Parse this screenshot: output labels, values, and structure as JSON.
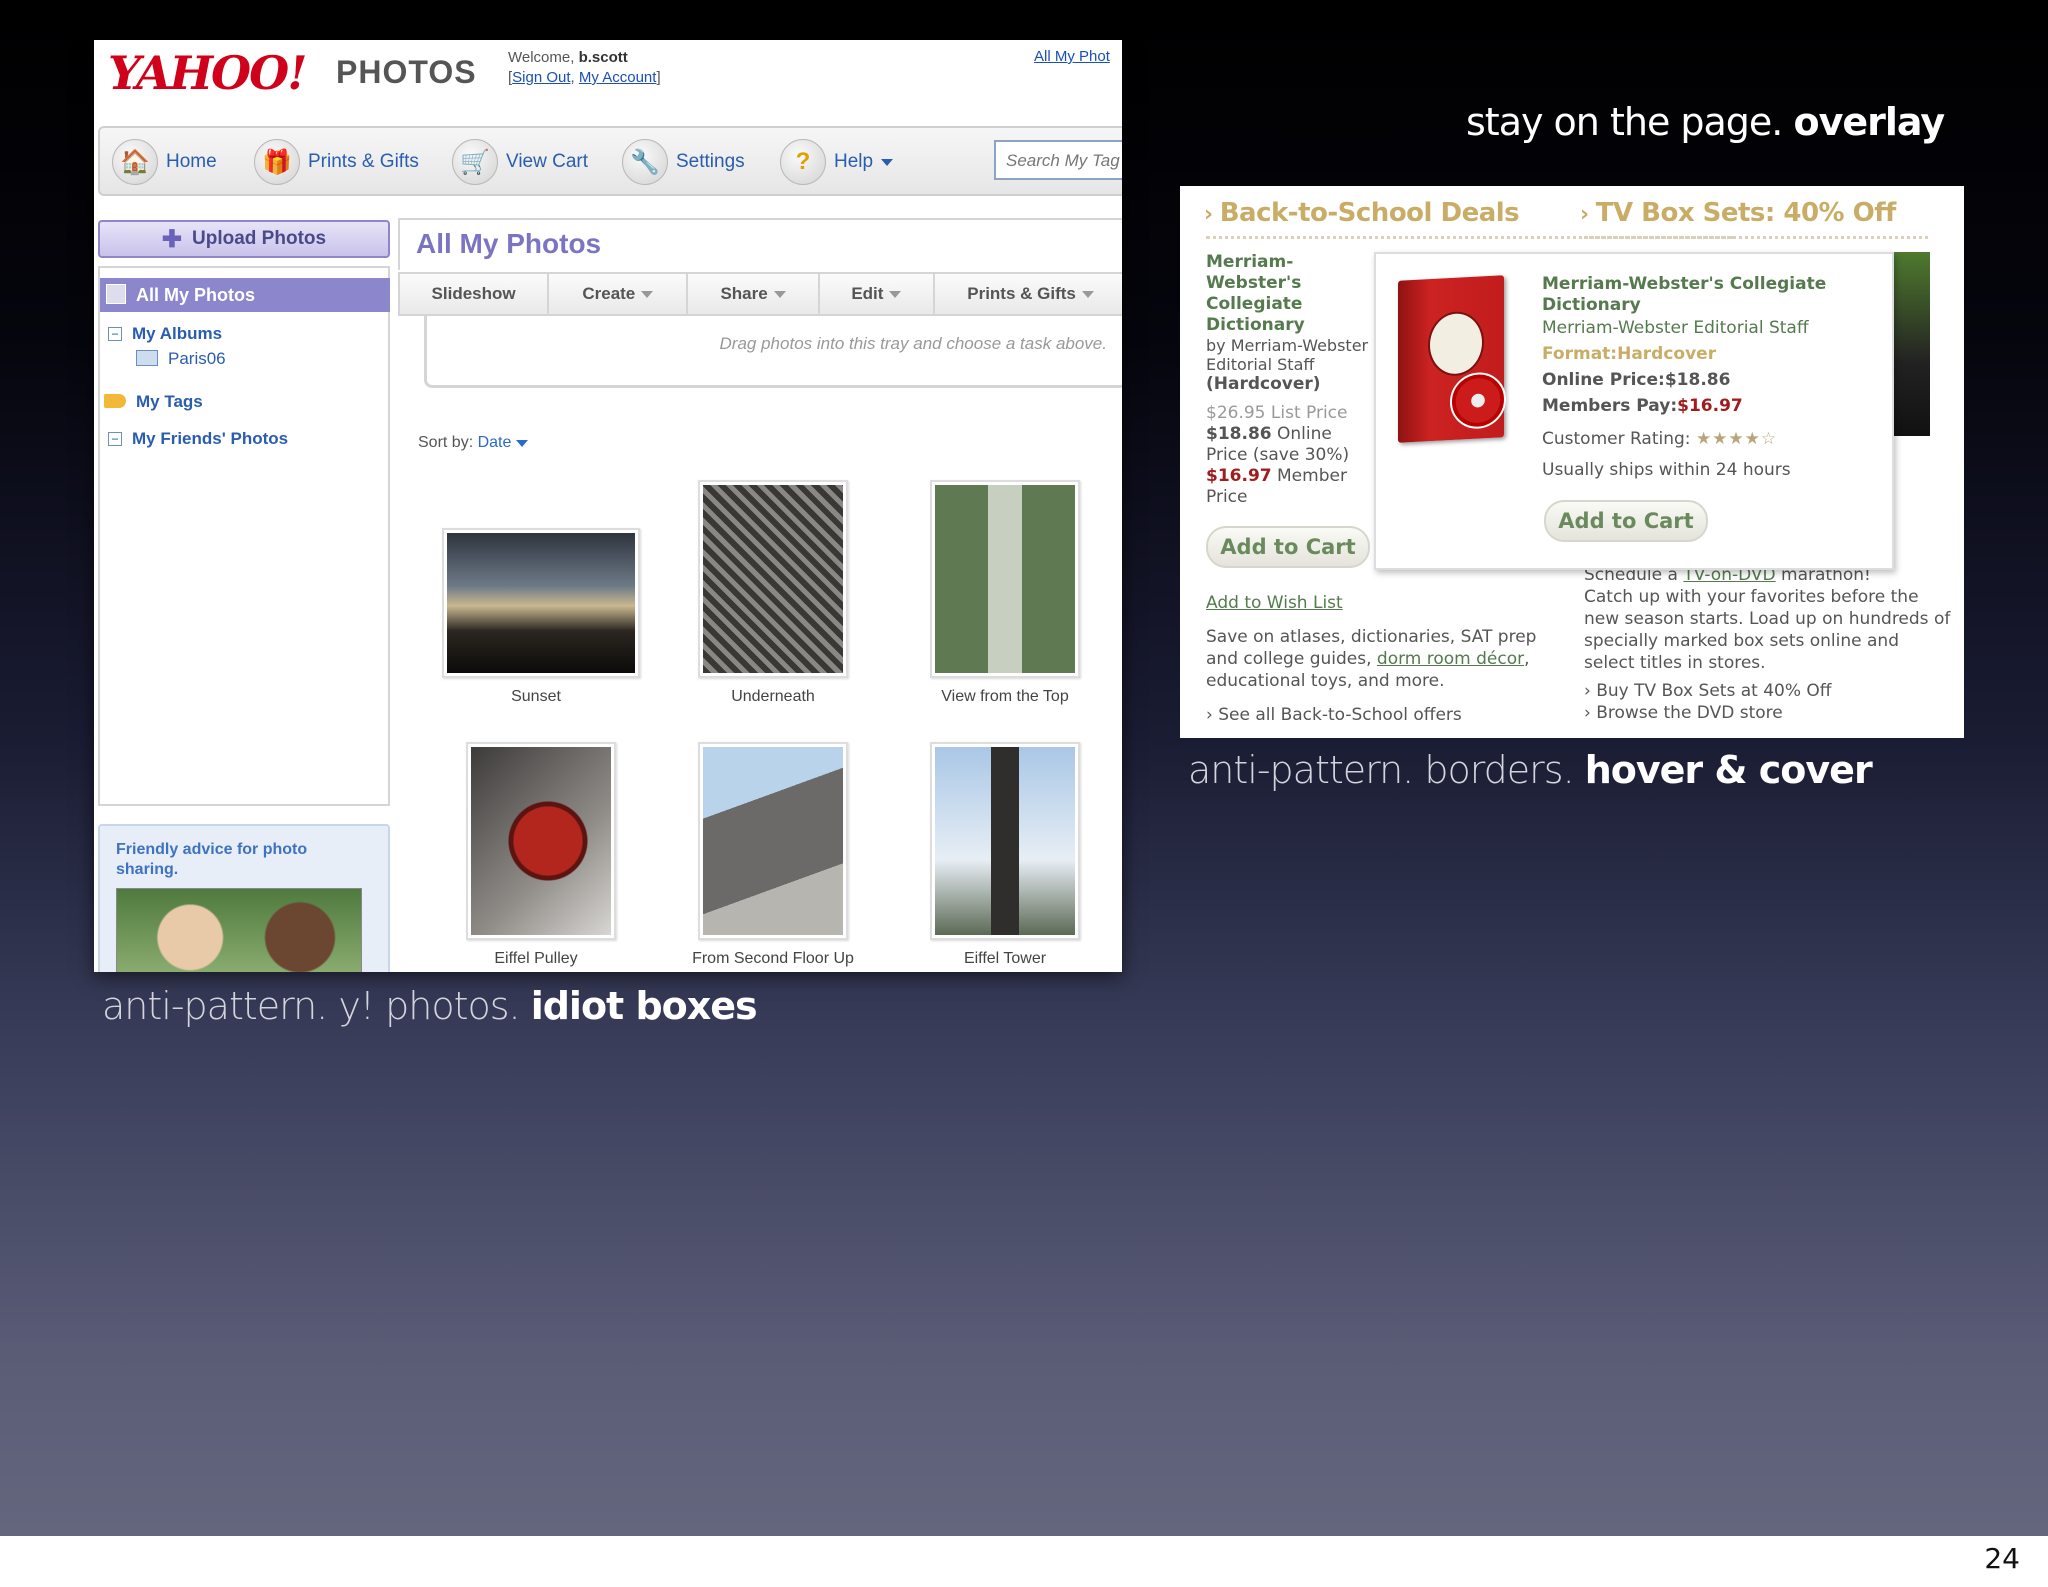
{
  "page_number": "24",
  "captions": {
    "left_pre": "anti-pattern. y! photos. ",
    "left_bold": "idiot boxes",
    "right_top_pre": "stay on the page. ",
    "right_top_bold": "overlay",
    "right_bottom_pre": "anti-pattern. borders. ",
    "right_bottom_bold": "hover & cover"
  },
  "yahoo": {
    "logo": "YAHOO!",
    "product": "PHOTOS",
    "welcome": "Welcome,",
    "user": "b.scott",
    "sign_out": "Sign Out",
    "my_account": "My Account",
    "all_my_photos_link": "All My Phot",
    "nav": [
      {
        "label": "Home",
        "icon": "home-icon"
      },
      {
        "label": "Prints & Gifts",
        "icon": "gift-icon"
      },
      {
        "label": "View Cart",
        "icon": "cart-icon"
      },
      {
        "label": "Settings",
        "icon": "wrench-icon"
      },
      {
        "label": "Help",
        "icon": "question-icon"
      }
    ],
    "search_placeholder": "Search My Tag",
    "upload_label": "Upload Photos",
    "sidebar": {
      "all_my_photos": "All My Photos",
      "my_albums": "My Albums",
      "album_paris": "Paris06",
      "my_tags": "My Tags",
      "my_friends_photos": "My Friends' Photos"
    },
    "advice": "Friendly advice for photo sharing.",
    "main_title": "All My Photos",
    "tabs": [
      "Slideshow",
      "Create",
      "Share",
      "Edit",
      "Prints & Gifts"
    ],
    "tray_hint": "Drag photos into this tray and choose a task above.",
    "sort_label": "Sort by:",
    "sort_value": "Date",
    "photos": [
      "Sunset",
      "Underneath",
      "View from the Top",
      "Eiffel Pulley",
      "From Second Floor Up",
      "Eiffel Tower"
    ]
  },
  "amazon": {
    "deal_left": "Back-to-School Deals",
    "deal_right": "TV Box Sets: 40% Off",
    "left_title": "Merriam-Webster's Collegiate Dictionary",
    "left_by": "by Merriam-Webster Editorial Staff",
    "left_format": "(Hardcover)",
    "left_list_price": "$26.95 List Price",
    "left_online_price": "$18.86",
    "left_online_suffix": "Online Price (save 30%)",
    "left_member_price": "$16.97",
    "left_member_suffix": "Member Price",
    "add_to_cart": "Add to Cart",
    "add_to_wish_list": "Add to Wish List",
    "save_text_pre": "Save on atlases, dictionaries, SAT prep and college guides, ",
    "save_text_link": "dorm room décor",
    "save_text_post": ", educational toys, and more.",
    "see_all": "› See all Back-to-School offers",
    "popup": {
      "title": "Merriam-Webster's Collegiate Dictionary",
      "author": "Merriam-Webster Editorial Staff",
      "format": "Format:Hardcover",
      "online_price": "Online Price:$18.86",
      "members_label": "Members Pay:",
      "members_price": "$16.97",
      "rating_label": "Customer Rating:",
      "rating_stars": "★★★★☆",
      "rating_value": 4.5,
      "ships": "Usually ships within 24 hours",
      "add_to_cart": "Add to Cart"
    },
    "right_schedule_pre": "Schedule a ",
    "right_schedule_link": "TV-on-DVD",
    "right_schedule_post": " marathon!",
    "right_body": "Catch up with your favorites before the new season starts. Load up on hundreds of specially marked box sets online and select titles in stores.",
    "buy_tv": "› Buy TV Box Sets at 40% Off",
    "browse_dvd": "› Browse the DVD store"
  }
}
